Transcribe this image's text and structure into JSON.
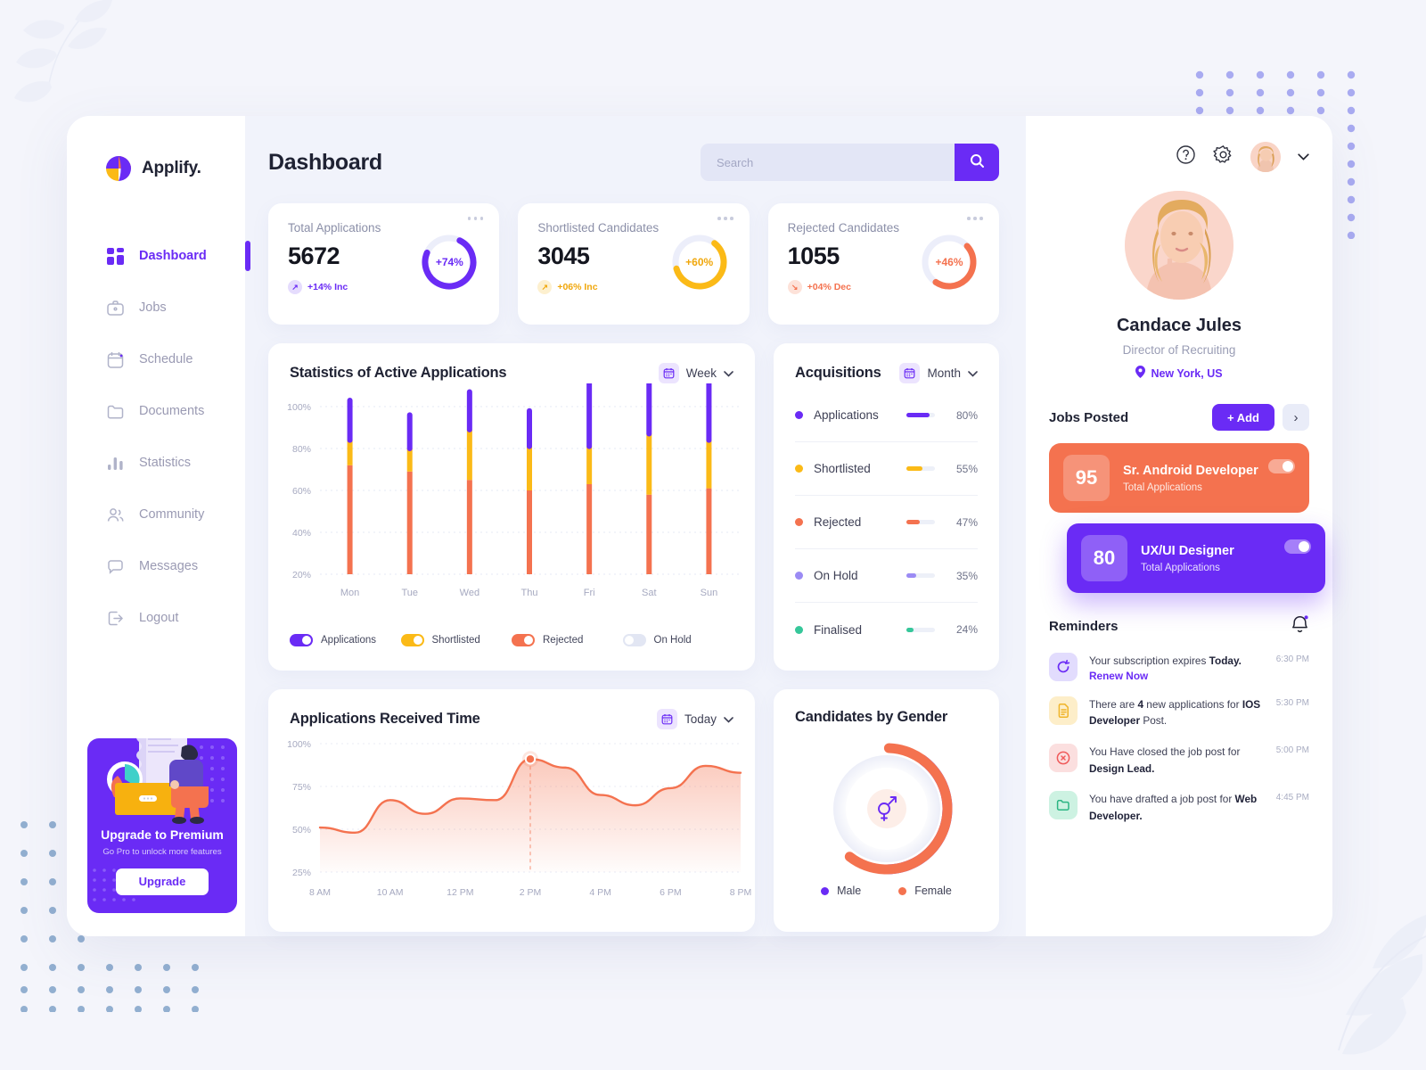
{
  "brand": {
    "name": "Applify.",
    "logo_icon": "applify-logo-icon"
  },
  "sidebar": {
    "items": [
      {
        "label": "Dashboard",
        "icon": "grid-icon",
        "active": true
      },
      {
        "label": "Jobs",
        "icon": "briefcase-icon",
        "active": false
      },
      {
        "label": "Schedule",
        "icon": "calendar-icon",
        "active": false
      },
      {
        "label": "Documents",
        "icon": "folder-icon",
        "active": false
      },
      {
        "label": "Statistics",
        "icon": "bar-chart-icon",
        "active": false
      },
      {
        "label": "Community",
        "icon": "users-icon",
        "active": false
      },
      {
        "label": "Messages",
        "icon": "chat-bubble-icon",
        "active": false
      },
      {
        "label": "Logout",
        "icon": "logout-icon",
        "active": false
      }
    ],
    "promo": {
      "title": "Upgrade to Premium",
      "subtitle": "Go Pro to unlock more features",
      "button": "Upgrade"
    }
  },
  "header": {
    "title": "Dashboard",
    "search": {
      "placeholder": "Search",
      "value": "",
      "icon": "search-icon"
    }
  },
  "stats": [
    {
      "label": "Total Applications",
      "value": "5672",
      "delta": "+14% Inc",
      "delta_dir": "up",
      "ring_pct": "+74%",
      "ring_value": 74,
      "color": "#6a2bf5",
      "tint": "#ece4fe"
    },
    {
      "label": "Shortlisted Candidates",
      "value": "3045",
      "delta": "+06% Inc",
      "delta_dir": "up",
      "ring_pct": "+60%",
      "ring_value": 60,
      "color": "#fbba17",
      "tint": "#fef3da"
    },
    {
      "label": "Rejected Candidates",
      "value": "1055",
      "delta": "+04% Dec",
      "delta_dir": "down",
      "ring_pct": "+46%",
      "ring_value": 46,
      "color": "#f4724f",
      "tint": "#fde7e0"
    }
  ],
  "chart_data": [
    {
      "type": "bar",
      "title": "Statistics of Active Applications",
      "range_label": "Week",
      "stacked": true,
      "categories": [
        "Mon",
        "Tue",
        "Wed",
        "Thu",
        "Fri",
        "Sat",
        "Sun"
      ],
      "series": [
        {
          "name": "Rejected",
          "color": "#f4724f",
          "values": [
            52,
            49,
            45,
            40,
            43,
            38,
            41
          ]
        },
        {
          "name": "Shortlisted",
          "color": "#fbba17",
          "values": [
            12,
            11,
            24,
            21,
            18,
            29,
            23
          ]
        },
        {
          "name": "Applications",
          "color": "#6a2bf5",
          "values": [
            19,
            16,
            18,
            17,
            33,
            30,
            27
          ]
        }
      ],
      "ytick_labels": [
        "100%",
        "80%",
        "60%",
        "40%",
        "20%"
      ],
      "ylim": [
        20,
        100
      ],
      "grid": true,
      "legend": [
        {
          "label": "Applications",
          "color": "#6a2bf5",
          "on": true
        },
        {
          "label": "Shortlisted",
          "color": "#fbba17",
          "on": true
        },
        {
          "label": "Rejected",
          "color": "#f4724f",
          "on": true
        },
        {
          "label": "On Hold",
          "color": "#e2e6f3",
          "on": false
        }
      ]
    },
    {
      "type": "bar",
      "title": "Acquisitions",
      "range_label": "Month",
      "orientation": "horizontal",
      "categories": [
        "Applications",
        "Shortlisted",
        "Rejected",
        "On Hold",
        "Finalised"
      ],
      "values": [
        80,
        55,
        47,
        35,
        24
      ],
      "value_labels": [
        "80%",
        "55%",
        "47%",
        "35%",
        "24%"
      ],
      "colors": [
        "#6a2bf5",
        "#fbba17",
        "#f4724f",
        "#9b8bf4",
        "#36c79a"
      ],
      "xlim": [
        0,
        100
      ]
    },
    {
      "type": "area",
      "title": "Applications Received Time",
      "range_label": "Today",
      "color": "#f4724f",
      "x": [
        "8 AM",
        "10 AM",
        "12 PM",
        "2 PM",
        "4 PM",
        "6 PM",
        "8 PM"
      ],
      "ytick_labels": [
        "100%",
        "75%",
        "50%",
        "25%"
      ],
      "ylim": [
        25,
        100
      ],
      "grid": true,
      "points": [
        {
          "t": "8 AM",
          "v": 51
        },
        {
          "t": "9 AM",
          "v": 48
        },
        {
          "t": "10 AM",
          "v": 67
        },
        {
          "t": "11 AM",
          "v": 59
        },
        {
          "t": "12 PM",
          "v": 68
        },
        {
          "t": "1 PM",
          "v": 67
        },
        {
          "t": "2 PM",
          "v": 91
        },
        {
          "t": "3 PM",
          "v": 86
        },
        {
          "t": "4 PM",
          "v": 70
        },
        {
          "t": "5 PM",
          "v": 64
        },
        {
          "t": "6 PM",
          "v": 74
        },
        {
          "t": "7 PM",
          "v": 87
        },
        {
          "t": "8 PM",
          "v": 83
        }
      ],
      "marker": {
        "t": "2 PM",
        "v": 91
      }
    },
    {
      "type": "pie",
      "title": "Candidates by Gender",
      "labels": [
        "Male",
        "Female"
      ],
      "values": [
        40,
        60
      ],
      "colors": [
        "#6a2bf5",
        "#f4724f"
      ],
      "donut": true,
      "center_icon": "gender-icon",
      "legend_position": "bottom"
    }
  ],
  "profile": {
    "name": "Candace Jules",
    "role": "Director of Recruiting",
    "location": "New York, US",
    "location_icon": "map-pin-icon",
    "help_icon": "help-circle-icon",
    "settings_icon": "gear-icon",
    "avatar_icon": "avatar",
    "chevron_icon": "chevron-down-icon"
  },
  "jobs": {
    "title": "Jobs Posted",
    "add_label": "+ Add",
    "next_label": "›",
    "items": [
      {
        "count": "95",
        "title": "Sr. Android Developer",
        "sub": "Total Applications",
        "color": "#f4724f",
        "toggle_on": true
      },
      {
        "count": "80",
        "title": "UX/UI Designer",
        "sub": "Total Applications",
        "color": "#6a2bf5",
        "toggle_on": true
      }
    ]
  },
  "reminders": {
    "title": "Reminders",
    "bell_icon": "bell-icon",
    "items": [
      {
        "icon": "refresh-icon",
        "tint": "#e2dcfd",
        "stroke": "#6a2bf5",
        "text_pre": "Your subscription expires ",
        "text_bold": "Today.",
        "text_post": "",
        "link": "Renew Now",
        "time": "6:30 PM"
      },
      {
        "icon": "document-icon",
        "tint": "#fdeec9",
        "stroke": "#f0b429",
        "text_pre": "There are ",
        "text_bold": "4",
        "text_post": " new applications for ",
        "text_bold2": "IOS Developer",
        "text_post2": " Post.",
        "time": "5:30 PM"
      },
      {
        "icon": "close-circle-icon",
        "tint": "#fbdfdf",
        "stroke": "#f05a5a",
        "text_pre": "You Have closed the job post for ",
        "text_bold": "Design Lead.",
        "text_post": "",
        "time": "5:00 PM"
      },
      {
        "icon": "folder-icon",
        "tint": "#cdf2e2",
        "stroke": "#2bb583",
        "text_pre": "You have drafted a job post for ",
        "text_bold": "Web Developer.",
        "text_post": "",
        "time": "4:45 PM"
      }
    ]
  }
}
